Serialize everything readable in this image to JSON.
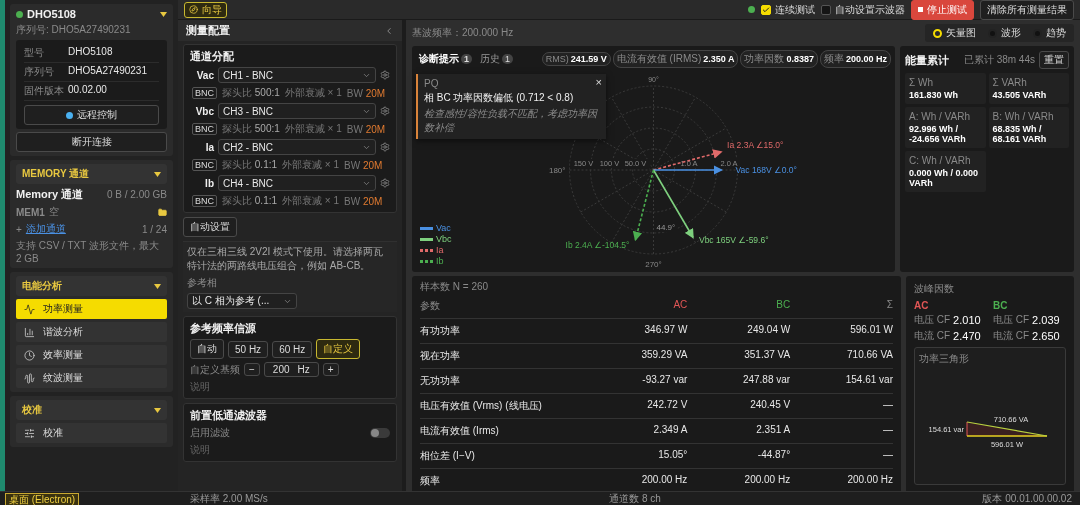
{
  "toolbar": {
    "guide_button": "向导",
    "online": true,
    "checks": [
      {
        "label": "连续测试",
        "checked": true
      },
      {
        "label": "自动设置示波器",
        "checked": false
      }
    ],
    "stop_button": "停止测试",
    "clear_button": "清除所有测量结果"
  },
  "sidebar": {
    "device": {
      "name": "DHO5108",
      "online": true,
      "serial": "序列号: DHO5A27490231",
      "info": [
        {
          "label": "型号",
          "value": "DHO5108"
        },
        {
          "label": "序列号",
          "value": "DHO5A27490231"
        },
        {
          "label": "固件版本",
          "value": "00.02.00"
        }
      ],
      "remote_button": "远程控制",
      "disconnect_button": "断开连接"
    },
    "memory": {
      "section": "MEMORY 通道",
      "title": "Memory 通道",
      "usage": "0 B / 2.00 GB",
      "item": "MEM1",
      "item_tag": "空",
      "add_prefix": "+",
      "add_link": "添加通道",
      "count": "1 / 24",
      "hint": "支持 CSV / TXT 波形文件，最大 2 GB"
    },
    "groups": [
      {
        "title": "电能分析",
        "items": [
          {
            "label": "功率测量",
            "kind": "power",
            "selected": true
          },
          {
            "label": "谐波分析",
            "kind": "harmonic",
            "selected": false
          },
          {
            "label": "效率测量",
            "kind": "efficiency",
            "selected": false
          },
          {
            "label": "纹波测量",
            "kind": "ripple",
            "selected": false
          }
        ]
      },
      {
        "title": "校准",
        "items": [
          {
            "label": "校准",
            "kind": "calibration",
            "selected": false
          }
        ]
      }
    ]
  },
  "config": {
    "title": "测量配置",
    "channels_title": "通道分配",
    "channels": [
      {
        "name": "Vac",
        "source": "CH1 - BNC",
        "tag": "BNC",
        "ratio_label": "探头比",
        "ratio": "500:1",
        "atten": "外部衰减 × 1",
        "bw_label": "BW",
        "bw": "20M"
      },
      {
        "name": "Vbc",
        "source": "CH3 - BNC",
        "tag": "BNC",
        "ratio_label": "探头比",
        "ratio": "500:1",
        "atten": "外部衰减 × 1",
        "bw_label": "BW",
        "bw": "20M"
      },
      {
        "name": "Ia",
        "source": "CH2 - BNC",
        "tag": "BNC",
        "ratio_label": "探头比",
        "ratio": "0.1:1",
        "atten": "外部衰减 × 1",
        "bw_label": "BW",
        "bw": "20M"
      },
      {
        "name": "Ib",
        "source": "CH4 - BNC",
        "tag": "BNC",
        "ratio_label": "探头比",
        "ratio": "0.1:1",
        "atten": "外部衰减 × 1",
        "bw_label": "BW",
        "bw": "20M"
      }
    ],
    "auto_button": "自动设置",
    "note": "仅在三相三线 2V2I 模式下使用。请选择两瓦特计法的两路线电压组合，例如 AB-CB。",
    "ref_label": "参考相",
    "ref_value": "以 C 相为参考 (...",
    "freq_source": {
      "title": "参考频率信源",
      "options": [
        {
          "label": "自动",
          "selected": false
        },
        {
          "label": "50 Hz",
          "selected": false
        },
        {
          "label": "60 Hz",
          "selected": false
        },
        {
          "label": "自定义",
          "selected": true
        }
      ],
      "custom_label": "自定义基频",
      "minus": "−",
      "value": "200",
      "unit": "Hz",
      "plus": "+",
      "help": "说明"
    },
    "filter": {
      "title": "前置低通滤波器",
      "toggle_label": "启用滤波",
      "on": false,
      "help": "说明"
    }
  },
  "main": {
    "fundamental": "基波频率：200.000 Hz",
    "views": [
      {
        "label": "矢量图",
        "selected": true
      },
      {
        "label": "波形",
        "selected": false
      },
      {
        "label": "趋势",
        "selected": false
      }
    ],
    "phasor_panel": {
      "tabs": [
        {
          "label": "诊断提示",
          "badge": "1",
          "selected": true
        },
        {
          "label": "历史",
          "badge": "1",
          "selected": false
        }
      ],
      "metrics": [
        {
          "label": "RMS)",
          "value": "241.59 V"
        },
        {
          "label": "电流有效值 (IRMS)",
          "value": "2.350 A"
        },
        {
          "label": "功率因数",
          "value": "0.8387"
        },
        {
          "label": "频率",
          "value": "200.00 Hz"
        }
      ],
      "alert": {
        "tag": "PQ",
        "title": "相 BC 功率因数偏低 (0.712 < 0.8)",
        "hint": "检查感性/容性负载不匹配，考虑功率因数补偿",
        "close": "×"
      },
      "diagram": {
        "angles": [
          "90°",
          "180°",
          "270°"
        ],
        "volt_rings": [
          "150 V",
          "100 V",
          "50.0 V"
        ],
        "amp_rings": [
          "1.0 A",
          "2.0 A"
        ],
        "phase_angle": "44.9°",
        "vectors": [
          {
            "label": "Ia 2.3A ∠15.0°",
            "kind": "dashed"
          },
          {
            "label": "Vac 168V ∠0.0°",
            "kind": "solid"
          },
          {
            "label": "Vbc 165V ∠-59.6°",
            "kind": "solid"
          },
          {
            "label": "Ib 2.4A ∠-104.5°",
            "kind": "dashed"
          }
        ],
        "legend": [
          {
            "label": "Vac",
            "color": "#4a90e2",
            "kind": "solid"
          },
          {
            "label": "Vbc",
            "color": "#7ed07e",
            "kind": "solid"
          },
          {
            "label": "Ia",
            "color": "#e06a6a",
            "kind": "dashed"
          },
          {
            "label": "Ib",
            "color": "#4caf50",
            "kind": "dashed"
          }
        ]
      }
    }
  },
  "energy": {
    "title": "能量累计",
    "elapsed": "已累计 38m 44s",
    "reset_button": "重置",
    "cells": [
      {
        "label": "Σ Wh",
        "value": "161.830 Wh"
      },
      {
        "label": "Σ VARh",
        "value": "43.505 VARh"
      },
      {
        "label": "A: Wh / VARh",
        "value": "92.996 Wh / -24.656 VARh"
      },
      {
        "label": "B: Wh / VARh",
        "value": "68.835 Wh / 68.161 VARh"
      },
      {
        "label": "C: Wh / VARh",
        "value": "0.000 Wh / 0.000 VARh"
      }
    ]
  },
  "table": {
    "samples": "样本数 N = 260",
    "columns": [
      {
        "label": "参数"
      },
      {
        "label": "AC",
        "color": "#e05555"
      },
      {
        "label": "BC",
        "color": "#4caf50"
      },
      {
        "label": "Σ"
      }
    ],
    "rows": [
      [
        "有功功率",
        "346.97 W",
        "249.04 W",
        "596.01 W"
      ],
      [
        "视在功率",
        "359.29 VA",
        "351.37 VA",
        "710.66 VA"
      ],
      [
        "无功功率",
        "-93.27 var",
        "247.88 var",
        "154.61 var"
      ],
      [
        "电压有效值 (Vrms) (线电压)",
        "242.72 V",
        "240.45 V",
        "—"
      ],
      [
        "电流有效值 (Irms)",
        "2.349 A",
        "2.351 A",
        "—"
      ],
      [
        "相位差 (I−V)",
        "15.05°",
        "-44.87°",
        "—"
      ],
      [
        "频率",
        "200.00 Hz",
        "200.00 Hz",
        "200.00 Hz"
      ]
    ]
  },
  "crest": {
    "title": "波峰因数",
    "phases": [
      {
        "name": "AC",
        "color": "#e05555",
        "rows": [
          {
            "label": "电压 CF",
            "value": "2.010"
          },
          {
            "label": "电流 CF",
            "value": "2.470"
          }
        ]
      },
      {
        "name": "BC",
        "color": "#4caf50",
        "rows": [
          {
            "label": "电压 CF",
            "value": "2.039"
          },
          {
            "label": "电流 CF",
            "value": "2.650"
          }
        ]
      }
    ]
  },
  "triangle": {
    "title": "功率三角形",
    "reactive": "154.61 var",
    "apparent": "710.66 VA",
    "active": "596.01 W"
  },
  "status_bar": {
    "platform": "桌面 (Electron)",
    "sample_rate": "采样率 2.00 MS/s",
    "channels": "通道数 8 ch",
    "version": "版本 00.01.00.00.02"
  }
}
